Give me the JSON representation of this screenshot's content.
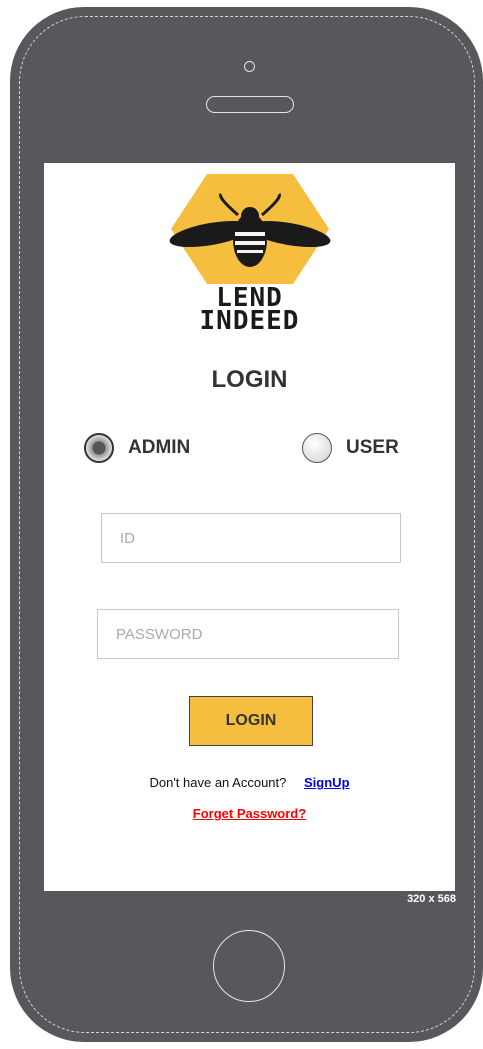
{
  "device": {
    "size_label": "320 x 568"
  },
  "brand": {
    "line1": "LEND",
    "line2": "INDEED",
    "logo_icon": "bee-icon",
    "hex_color": "#f5be3e"
  },
  "login": {
    "title": "LOGIN",
    "role_options": [
      {
        "label": "ADMIN",
        "selected": true
      },
      {
        "label": "USER",
        "selected": false
      }
    ],
    "id_placeholder": "ID",
    "password_placeholder": "PASSWORD",
    "button_label": "LOGIN",
    "signup_question": "Don't have an Account?",
    "signup_link": "SignUp",
    "forgot_link": "Forget Password?"
  },
  "colors": {
    "phone_body": "#58575c",
    "button": "#f5be3e",
    "link": "#0000ee",
    "forgot": "#ff0000"
  }
}
